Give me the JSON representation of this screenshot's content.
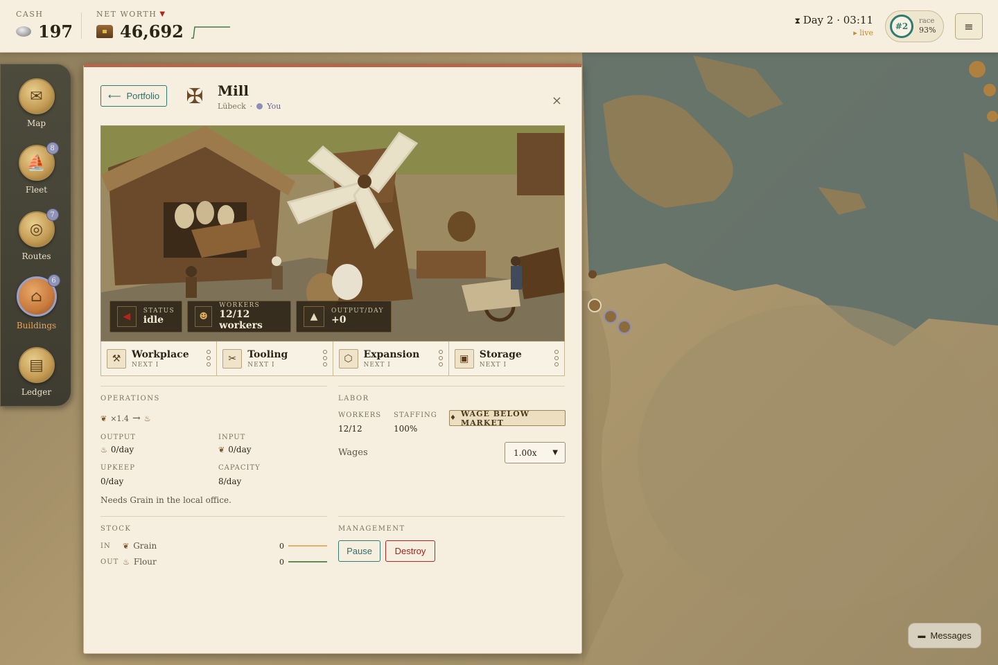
{
  "topbar": {
    "cash_label": "CASH",
    "cash_value": "197",
    "networth_label": "NET WORTH",
    "networth_trend_icon": "down-triangle",
    "networth_value": "46,692",
    "clock_icon": "hourglass",
    "day_time": "Day 2 · 03:11",
    "live_text": "▸ live",
    "rank": "#2",
    "race_label": "race",
    "race_pct": "93%",
    "menu_icon": "≡"
  },
  "dock": [
    {
      "label": "Map",
      "icon": "map-scroll-icon",
      "glyph": "✉",
      "badge": ""
    },
    {
      "label": "Fleet",
      "icon": "ship-icon",
      "glyph": "⛵",
      "badge": "8"
    },
    {
      "label": "Routes",
      "icon": "rope-icon",
      "glyph": "◎",
      "badge": "7"
    },
    {
      "label": "Buildings",
      "icon": "building-icon",
      "glyph": "⌂",
      "badge": "6",
      "active": true
    },
    {
      "label": "Ledger",
      "icon": "book-icon",
      "glyph": "▤",
      "badge": ""
    }
  ],
  "panel": {
    "back_label": "Portfolio",
    "back_icon": "⟵",
    "title": "Mill",
    "city": "Lübeck",
    "separator": "·",
    "owner": "You",
    "close_icon": "×",
    "chips": {
      "status_label": "STATUS",
      "status_value": "idle",
      "workers_label": "WORKERS",
      "workers_value": "12/12 workers",
      "output_label": "OUTPUT/DAY",
      "output_value": "+0"
    },
    "upgrades": [
      {
        "name": "Workplace",
        "next": "NEXT I",
        "icon": "workbench-icon",
        "glyph": "⚒"
      },
      {
        "name": "Tooling",
        "next": "NEXT I",
        "icon": "tools-icon",
        "glyph": "✂"
      },
      {
        "name": "Expansion",
        "next": "NEXT I",
        "icon": "expand-icon",
        "glyph": "⬡"
      },
      {
        "name": "Storage",
        "next": "NEXT I",
        "icon": "storage-icon",
        "glyph": "▣"
      }
    ],
    "operations": {
      "title": "OPERATIONS",
      "recipe_mult": "×1.4",
      "recipe_arrow": "→",
      "output_label": "OUTPUT",
      "output_value": "0/day",
      "input_label": "INPUT",
      "input_value": "0/day",
      "upkeep_label": "UPKEEP",
      "upkeep_value": "0/day",
      "capacity_label": "CAPACITY",
      "capacity_value": "8/day",
      "note": "Needs Grain in the local office."
    },
    "labor": {
      "title": "LABOR",
      "workers_label": "WORKERS",
      "workers_value": "12/12",
      "staffing_label": "STAFFING",
      "staffing_value": "100%",
      "warning": "WAGE BELOW MARKET",
      "wages_label": "Wages",
      "wage_selected": "1.00x"
    },
    "stock": {
      "title": "STOCK",
      "rows": [
        {
          "dir": "IN",
          "name": "Grain",
          "qty": "0",
          "color": "#e3b066"
        },
        {
          "dir": "OUT",
          "name": "Flour",
          "qty": "0",
          "color": "#5f8a54"
        }
      ]
    },
    "management": {
      "title": "MANAGEMENT",
      "pause_label": "Pause",
      "destroy_label": "Destroy"
    }
  },
  "messages_label": "Messages",
  "colors": {
    "accent_teal": "#2f7a73",
    "danger": "#b3251d",
    "panel_bg": "#f6efdf",
    "owner": "#8a8fb8"
  }
}
